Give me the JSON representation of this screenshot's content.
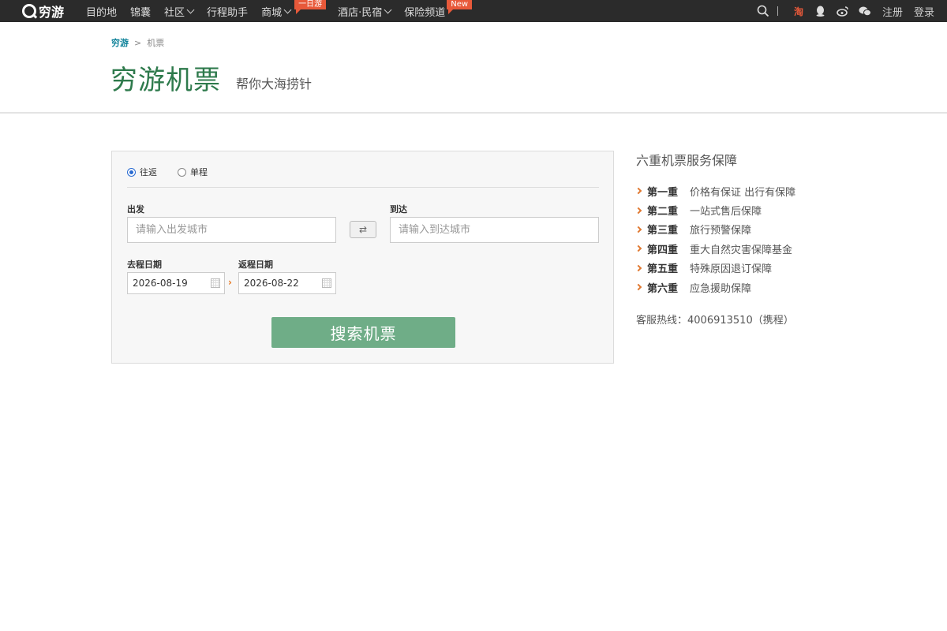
{
  "nav": {
    "logo_text": "穷游",
    "items": [
      {
        "label": "目的地",
        "has_dropdown": false
      },
      {
        "label": "锦囊",
        "has_dropdown": false
      },
      {
        "label": "社区",
        "has_dropdown": true
      },
      {
        "label": "行程助手",
        "has_dropdown": false
      },
      {
        "label": "商城",
        "has_dropdown": true,
        "tag": "一日游"
      },
      {
        "label": "酒店·民宿",
        "has_dropdown": true
      },
      {
        "label": "保险频道",
        "has_dropdown": false,
        "tag": "New"
      }
    ],
    "right": {
      "search_icon": "search-icon",
      "taobao_icon_label": "淘",
      "register": "注册",
      "login": "登录"
    }
  },
  "breadcrumb": {
    "home": "穷游",
    "separator": ">",
    "current": "机票"
  },
  "header": {
    "title": "穷游机票",
    "subtitle": "帮你大海捞针"
  },
  "search": {
    "trip_types": [
      {
        "label": "往返",
        "selected": true
      },
      {
        "label": "单程",
        "selected": false
      }
    ],
    "from_label": "出发",
    "from_placeholder": "请输入出发城市",
    "to_label": "到达",
    "to_placeholder": "请输入到达城市",
    "depart_label": "去程日期",
    "depart_value": "2026-08-19",
    "return_label": "返程日期",
    "return_value": "2026-08-22",
    "date_arrow": "›",
    "swap_icon": "⇄",
    "button_label": "搜索机票"
  },
  "guarantee": {
    "title": "六重机票服务保障",
    "items": [
      {
        "level": "第一重",
        "desc": "价格有保证 出行有保障"
      },
      {
        "level": "第二重",
        "desc": "一站式售后保障"
      },
      {
        "level": "第三重",
        "desc": "旅行预警保障"
      },
      {
        "level": "第四重",
        "desc": "重大自然灾害保障基金"
      },
      {
        "level": "第五重",
        "desc": "特殊原因退订保障"
      },
      {
        "level": "第六重",
        "desc": "应急援助保障"
      }
    ],
    "hotline": "客服热线：4006913510（携程）"
  },
  "colors": {
    "accent_green": "#2e7a4c",
    "button_green": "#6fad87",
    "tag_orange": "#e8593a",
    "link_blue": "#10839a"
  }
}
